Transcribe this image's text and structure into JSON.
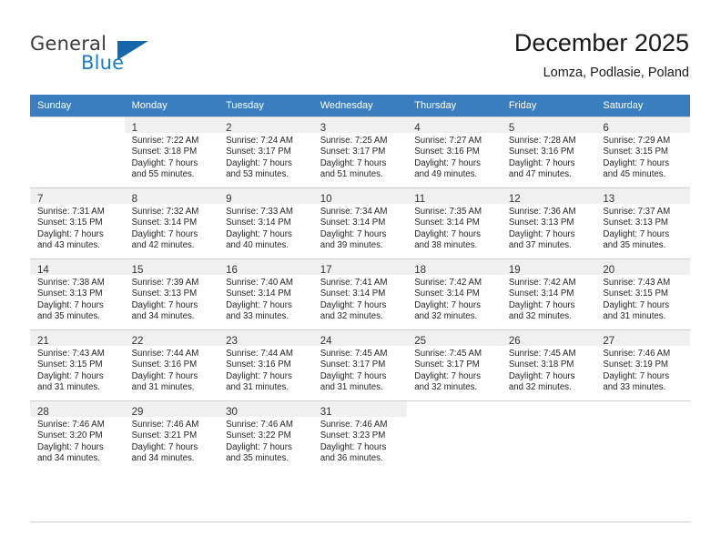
{
  "brand": {
    "word1": "General",
    "word2": "Blue",
    "flag_color": "#1566ab",
    "blue_color": "#1a7ec8"
  },
  "header": {
    "title": "December 2025",
    "subtitle": "Lomza, Podlasie, Poland",
    "header_bg": "#3a7ebf"
  },
  "weekday_headers": [
    "Sunday",
    "Monday",
    "Tuesday",
    "Wednesday",
    "Thursday",
    "Friday",
    "Saturday"
  ],
  "labels": {
    "sunrise_prefix": "Sunrise:",
    "sunset_prefix": "Sunset:",
    "daylight_prefix": "Daylight:"
  },
  "weeks": [
    {
      "days": [
        {
          "day": "",
          "l1": "",
          "l2": "",
          "l3": "",
          "l4": ""
        },
        {
          "day": "1",
          "l1": "Sunrise: 7:22 AM",
          "l2": "Sunset: 3:18 PM",
          "l3": "Daylight: 7 hours",
          "l4": "and 55 minutes."
        },
        {
          "day": "2",
          "l1": "Sunrise: 7:24 AM",
          "l2": "Sunset: 3:17 PM",
          "l3": "Daylight: 7 hours",
          "l4": "and 53 minutes."
        },
        {
          "day": "3",
          "l1": "Sunrise: 7:25 AM",
          "l2": "Sunset: 3:17 PM",
          "l3": "Daylight: 7 hours",
          "l4": "and 51 minutes."
        },
        {
          "day": "4",
          "l1": "Sunrise: 7:27 AM",
          "l2": "Sunset: 3:16 PM",
          "l3": "Daylight: 7 hours",
          "l4": "and 49 minutes."
        },
        {
          "day": "5",
          "l1": "Sunrise: 7:28 AM",
          "l2": "Sunset: 3:16 PM",
          "l3": "Daylight: 7 hours",
          "l4": "and 47 minutes."
        },
        {
          "day": "6",
          "l1": "Sunrise: 7:29 AM",
          "l2": "Sunset: 3:15 PM",
          "l3": "Daylight: 7 hours",
          "l4": "and 45 minutes."
        }
      ]
    },
    {
      "days": [
        {
          "day": "7",
          "l1": "Sunrise: 7:31 AM",
          "l2": "Sunset: 3:15 PM",
          "l3": "Daylight: 7 hours",
          "l4": "and 43 minutes."
        },
        {
          "day": "8",
          "l1": "Sunrise: 7:32 AM",
          "l2": "Sunset: 3:14 PM",
          "l3": "Daylight: 7 hours",
          "l4": "and 42 minutes."
        },
        {
          "day": "9",
          "l1": "Sunrise: 7:33 AM",
          "l2": "Sunset: 3:14 PM",
          "l3": "Daylight: 7 hours",
          "l4": "and 40 minutes."
        },
        {
          "day": "10",
          "l1": "Sunrise: 7:34 AM",
          "l2": "Sunset: 3:14 PM",
          "l3": "Daylight: 7 hours",
          "l4": "and 39 minutes."
        },
        {
          "day": "11",
          "l1": "Sunrise: 7:35 AM",
          "l2": "Sunset: 3:14 PM",
          "l3": "Daylight: 7 hours",
          "l4": "and 38 minutes."
        },
        {
          "day": "12",
          "l1": "Sunrise: 7:36 AM",
          "l2": "Sunset: 3:13 PM",
          "l3": "Daylight: 7 hours",
          "l4": "and 37 minutes."
        },
        {
          "day": "13",
          "l1": "Sunrise: 7:37 AM",
          "l2": "Sunset: 3:13 PM",
          "l3": "Daylight: 7 hours",
          "l4": "and 35 minutes."
        }
      ]
    },
    {
      "days": [
        {
          "day": "14",
          "l1": "Sunrise: 7:38 AM",
          "l2": "Sunset: 3:13 PM",
          "l3": "Daylight: 7 hours",
          "l4": "and 35 minutes."
        },
        {
          "day": "15",
          "l1": "Sunrise: 7:39 AM",
          "l2": "Sunset: 3:13 PM",
          "l3": "Daylight: 7 hours",
          "l4": "and 34 minutes."
        },
        {
          "day": "16",
          "l1": "Sunrise: 7:40 AM",
          "l2": "Sunset: 3:14 PM",
          "l3": "Daylight: 7 hours",
          "l4": "and 33 minutes."
        },
        {
          "day": "17",
          "l1": "Sunrise: 7:41 AM",
          "l2": "Sunset: 3:14 PM",
          "l3": "Daylight: 7 hours",
          "l4": "and 32 minutes."
        },
        {
          "day": "18",
          "l1": "Sunrise: 7:42 AM",
          "l2": "Sunset: 3:14 PM",
          "l3": "Daylight: 7 hours",
          "l4": "and 32 minutes."
        },
        {
          "day": "19",
          "l1": "Sunrise: 7:42 AM",
          "l2": "Sunset: 3:14 PM",
          "l3": "Daylight: 7 hours",
          "l4": "and 32 minutes."
        },
        {
          "day": "20",
          "l1": "Sunrise: 7:43 AM",
          "l2": "Sunset: 3:15 PM",
          "l3": "Daylight: 7 hours",
          "l4": "and 31 minutes."
        }
      ]
    },
    {
      "days": [
        {
          "day": "21",
          "l1": "Sunrise: 7:43 AM",
          "l2": "Sunset: 3:15 PM",
          "l3": "Daylight: 7 hours",
          "l4": "and 31 minutes."
        },
        {
          "day": "22",
          "l1": "Sunrise: 7:44 AM",
          "l2": "Sunset: 3:16 PM",
          "l3": "Daylight: 7 hours",
          "l4": "and 31 minutes."
        },
        {
          "day": "23",
          "l1": "Sunrise: 7:44 AM",
          "l2": "Sunset: 3:16 PM",
          "l3": "Daylight: 7 hours",
          "l4": "and 31 minutes."
        },
        {
          "day": "24",
          "l1": "Sunrise: 7:45 AM",
          "l2": "Sunset: 3:17 PM",
          "l3": "Daylight: 7 hours",
          "l4": "and 31 minutes."
        },
        {
          "day": "25",
          "l1": "Sunrise: 7:45 AM",
          "l2": "Sunset: 3:17 PM",
          "l3": "Daylight: 7 hours",
          "l4": "and 32 minutes."
        },
        {
          "day": "26",
          "l1": "Sunrise: 7:45 AM",
          "l2": "Sunset: 3:18 PM",
          "l3": "Daylight: 7 hours",
          "l4": "and 32 minutes."
        },
        {
          "day": "27",
          "l1": "Sunrise: 7:46 AM",
          "l2": "Sunset: 3:19 PM",
          "l3": "Daylight: 7 hours",
          "l4": "and 33 minutes."
        }
      ]
    },
    {
      "days": [
        {
          "day": "28",
          "l1": "Sunrise: 7:46 AM",
          "l2": "Sunset: 3:20 PM",
          "l3": "Daylight: 7 hours",
          "l4": "and 34 minutes."
        },
        {
          "day": "29",
          "l1": "Sunrise: 7:46 AM",
          "l2": "Sunset: 3:21 PM",
          "l3": "Daylight: 7 hours",
          "l4": "and 34 minutes."
        },
        {
          "day": "30",
          "l1": "Sunrise: 7:46 AM",
          "l2": "Sunset: 3:22 PM",
          "l3": "Daylight: 7 hours",
          "l4": "and 35 minutes."
        },
        {
          "day": "31",
          "l1": "Sunrise: 7:46 AM",
          "l2": "Sunset: 3:23 PM",
          "l3": "Daylight: 7 hours",
          "l4": "and 36 minutes."
        },
        {
          "day": "",
          "l1": "",
          "l2": "",
          "l3": "",
          "l4": ""
        },
        {
          "day": "",
          "l1": "",
          "l2": "",
          "l3": "",
          "l4": ""
        },
        {
          "day": "",
          "l1": "",
          "l2": "",
          "l3": "",
          "l4": ""
        }
      ]
    }
  ]
}
